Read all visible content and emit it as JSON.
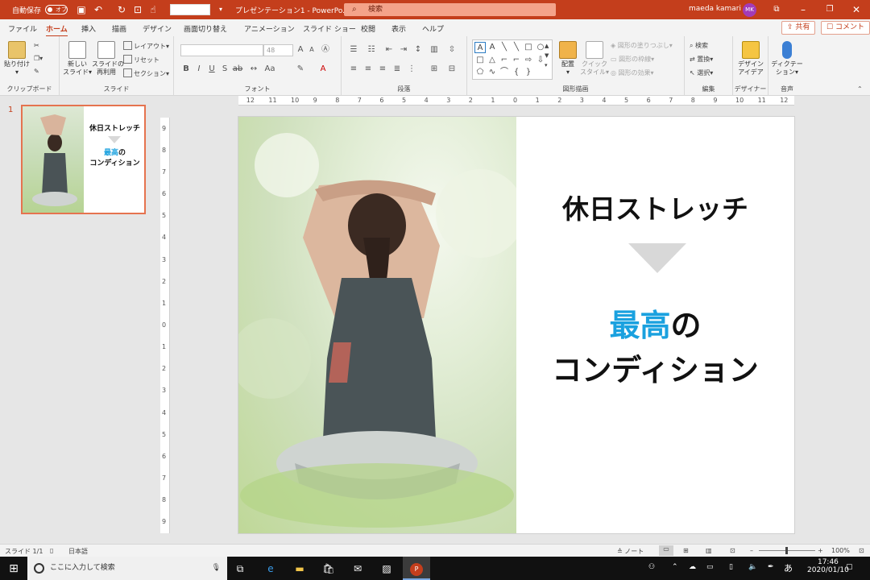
{
  "titlebar": {
    "autosave_label": "自動保存",
    "autosave_state": "オフ",
    "doc_title": "プレゼンテーション1 - PowerPo...",
    "search_placeholder": "検索",
    "user_name": "maeda kamari",
    "user_initials": "MK"
  },
  "tabs": [
    "ファイル",
    "ホーム",
    "挿入",
    "描画",
    "デザイン",
    "画面切り替え",
    "アニメーション",
    "スライド ショー",
    "校閲",
    "表示",
    "ヘルプ"
  ],
  "share_label": "共有",
  "comment_label": "コメント",
  "ribbon": {
    "clipboard": {
      "paste": "貼り付け",
      "group": "クリップボード"
    },
    "slides": {
      "new_slide_1": "新しい",
      "new_slide_2": "スライド",
      "reuse_1": "スライドの",
      "reuse_2": "再利用",
      "layout": "レイアウト",
      "reset": "リセット",
      "section": "セクション",
      "group": "スライド"
    },
    "font": {
      "size": "48",
      "group": "フォント"
    },
    "paragraph": {
      "group": "段落"
    },
    "drawing": {
      "arrange": "配置",
      "quick_style_1": "クイック",
      "quick_style_2": "スタイル",
      "fill": "図形の塗りつぶし",
      "outline": "図形の枠線",
      "effect": "図形の効果",
      "group": "図形描画"
    },
    "editing": {
      "find": "検索",
      "replace": "置換",
      "select": "選択",
      "group": "編集"
    },
    "designer": {
      "label_1": "デザイン",
      "label_2": "アイデア",
      "group": "デザイナー"
    },
    "voice": {
      "label_1": "ディクテー",
      "label_2": "ション",
      "group": "音声"
    }
  },
  "thumbnail": {
    "number": "1",
    "title": "休日ストレッチ",
    "highlight": "最高",
    "line2_rest": "の",
    "line3": "コンディション"
  },
  "slide": {
    "title": "休日ストレッチ",
    "highlight": "最高",
    "line2_rest": "の",
    "line3": "コンディション",
    "highlight_color": "#1aa1df",
    "arrow_color": "#d8d8d8"
  },
  "ruler": {
    "h_ticks": [
      "12",
      "11",
      "10",
      "9",
      "8",
      "7",
      "6",
      "5",
      "4",
      "3",
      "2",
      "1",
      "0",
      "1",
      "2",
      "3",
      "4",
      "5",
      "6",
      "7",
      "8",
      "9",
      "10",
      "11",
      "12"
    ],
    "v_ticks": [
      "9",
      "8",
      "7",
      "6",
      "5",
      "4",
      "3",
      "2",
      "1",
      "0",
      "1",
      "2",
      "3",
      "4",
      "5",
      "6",
      "7",
      "8",
      "9"
    ]
  },
  "statusbar": {
    "slide_info": "スライド 1/1",
    "language": "日本語",
    "notes": "ノート",
    "zoom": "100%"
  },
  "taskbar": {
    "search_placeholder": "ここに入力して検索",
    "time": "17:46",
    "date": "2020/01/10",
    "ime": "あ"
  },
  "colors": {
    "accent": "#c43e1c",
    "thumb_border": "#e5734f"
  }
}
